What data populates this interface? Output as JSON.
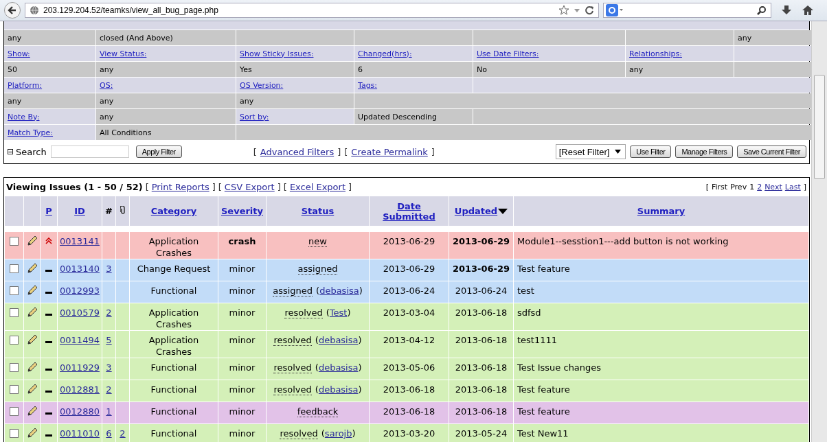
{
  "browser": {
    "url": "203.129.204.52/teamks/view_all_bug_page.php"
  },
  "filters": {
    "rows": [
      {
        "kind": "values",
        "cells": [
          "any",
          "closed (And Above)"
        ],
        "corner": "any"
      },
      {
        "kind": "labels",
        "cells": [
          "Show:",
          "View Status:",
          "Show Sticky Issues:",
          "Changed(hrs):",
          "Use Date Filters:",
          "Relationships:"
        ]
      },
      {
        "kind": "values",
        "cells": [
          "50",
          "any",
          "Yes",
          "6",
          "No",
          "any"
        ]
      },
      {
        "kind": "labels",
        "cells": [
          "Platform:",
          "OS:",
          "OS Version:",
          "Tags:"
        ]
      },
      {
        "kind": "values",
        "cells": [
          "any",
          "any",
          "any"
        ]
      },
      {
        "kind": "pairs",
        "cells": [
          "Note By:",
          "any",
          "Sort by:",
          "Updated Descending"
        ]
      },
      {
        "kind": "pairs",
        "cells": [
          "Match Type:",
          "All Conditions"
        ]
      }
    ],
    "toggle": "⊟",
    "search_label": "Search",
    "apply_button": "Apply Filter",
    "links": [
      {
        "open": "[",
        "text": "Advanced Filters",
        "close": "]"
      },
      {
        "open": "[",
        "text": "Create Permalink",
        "close": "]"
      }
    ],
    "reset_select": "[Reset Filter]",
    "buttons": [
      "Use Filter",
      "Manage Filters",
      "Save Current Filter"
    ]
  },
  "issues": {
    "title": "Viewing Issues (1 - 50 / 52)",
    "links": [
      {
        "open": "[",
        "text": "Print Reports",
        "close": "]"
      },
      {
        "open": "[",
        "text": "CSV Export",
        "close": "]"
      },
      {
        "open": "[",
        "text": "Excel Export",
        "close": "]"
      }
    ],
    "pagination": {
      "open": "[",
      "items": [
        {
          "text": "First",
          "link": false
        },
        {
          "text": "Prev",
          "link": false
        },
        {
          "text": "1",
          "link": false
        },
        {
          "text": "2",
          "link": true
        },
        {
          "text": "Next",
          "link": true
        },
        {
          "text": "Last",
          "link": true
        }
      ],
      "close": "]"
    },
    "columns": [
      {
        "kind": "blank"
      },
      {
        "kind": "blank"
      },
      {
        "kind": "link",
        "label": "P"
      },
      {
        "kind": "link",
        "label": "ID"
      },
      {
        "kind": "text",
        "label": "#"
      },
      {
        "kind": "clip"
      },
      {
        "kind": "link",
        "label": "Category"
      },
      {
        "kind": "link",
        "label": "Severity"
      },
      {
        "kind": "link",
        "label": "Status"
      },
      {
        "kind": "link",
        "label": "Date Submitted"
      },
      {
        "kind": "sorted",
        "label": "Updated"
      },
      {
        "kind": "link",
        "label": "Summary"
      }
    ],
    "rows": [
      {
        "checked": false,
        "urgent": true,
        "id": "0013141",
        "notes": "",
        "files": "",
        "category": "Application Crashes",
        "severity": "crash",
        "severe": true,
        "status": "new",
        "handler": null,
        "submitted": "2013-06-29",
        "updated": "2013-06-29",
        "recent": true,
        "summary": "Module1--sesstion1---add button is not working",
        "color": "#f8c0c0"
      },
      {
        "checked": false,
        "urgent": false,
        "id": "0013140",
        "notes": "3",
        "files": "",
        "category": "Change Request",
        "severity": "minor",
        "severe": false,
        "status": "assigned",
        "handler": null,
        "submitted": "2013-06-29",
        "updated": "2013-06-29",
        "recent": true,
        "summary": "Test feature",
        "color": "#c2dcf8"
      },
      {
        "checked": false,
        "urgent": false,
        "id": "0012993",
        "notes": "",
        "files": "",
        "category": "Functional",
        "severity": "minor",
        "severe": false,
        "status": "assigned",
        "handler": {
          "open": "(",
          "name": "debasisa",
          "close": ")"
        },
        "submitted": "2013-06-24",
        "updated": "2013-06-24",
        "recent": false,
        "summary": "test",
        "color": "#c2dcf8"
      },
      {
        "checked": false,
        "urgent": false,
        "id": "0010579",
        "notes": "2",
        "files": "",
        "category": "Application Crashes",
        "severity": "minor",
        "severe": false,
        "status": "resolved",
        "handler": {
          "open": "(",
          "name": "Test",
          "close": ")"
        },
        "submitted": "2013-03-04",
        "updated": "2013-06-18",
        "recent": false,
        "summary": "sdfsd",
        "color": "#d4f0b8"
      },
      {
        "checked": false,
        "urgent": false,
        "id": "0011494",
        "notes": "5",
        "files": "",
        "category": "Application Crashes",
        "severity": "minor",
        "severe": false,
        "status": "resolved",
        "handler": {
          "open": "(",
          "name": "debasisa",
          "close": ")"
        },
        "submitted": "2013-04-12",
        "updated": "2013-06-18",
        "recent": false,
        "summary": "test1111",
        "color": "#d4f0b8"
      },
      {
        "checked": false,
        "urgent": false,
        "id": "0011929",
        "notes": "3",
        "files": "",
        "category": "Functional",
        "severity": "minor",
        "severe": false,
        "status": "resolved",
        "handler": {
          "open": "(",
          "name": "debasisa",
          "close": ")"
        },
        "submitted": "2013-05-06",
        "updated": "2013-06-18",
        "recent": false,
        "summary": "Test Issue changes",
        "color": "#d4f0b8"
      },
      {
        "checked": false,
        "urgent": false,
        "id": "0012881",
        "notes": "2",
        "files": "",
        "category": "Functional",
        "severity": "minor",
        "severe": false,
        "status": "resolved",
        "handler": {
          "open": "(",
          "name": "debasisa",
          "close": ")"
        },
        "submitted": "2013-06-18",
        "updated": "2013-06-18",
        "recent": false,
        "summary": "Test feature",
        "color": "#d4f0b8"
      },
      {
        "checked": false,
        "urgent": false,
        "id": "0012880",
        "notes": "1",
        "files": "",
        "category": "Functional",
        "severity": "minor",
        "severe": false,
        "status": "feedback",
        "handler": null,
        "submitted": "2013-06-18",
        "updated": "2013-06-18",
        "recent": false,
        "summary": "Test feature",
        "color": "#e2c2e8"
      },
      {
        "checked": false,
        "urgent": false,
        "id": "0011010",
        "notes": "6",
        "files": "2",
        "category": "Functional",
        "severity": "minor",
        "severe": false,
        "status": "resolved",
        "handler": {
          "open": "(",
          "name": "sarojb",
          "close": ")"
        },
        "submitted": "2013-03-20",
        "updated": "2013-05-24",
        "recent": false,
        "summary": "Test New11",
        "color": "#d4f0b8"
      }
    ]
  }
}
